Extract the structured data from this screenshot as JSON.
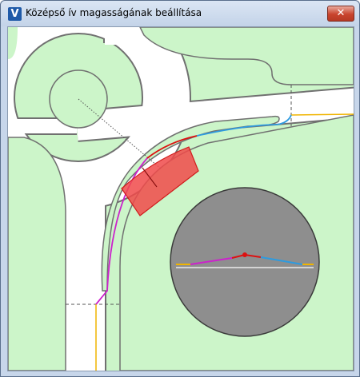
{
  "window": {
    "title": "Középső ív magasságának beállítása",
    "app_icon_letter": "V",
    "close_glyph": "✕"
  },
  "icons": {
    "app": "app-logo-icon",
    "close": "close-icon"
  },
  "colors": {
    "grass": "#ccf5c9",
    "road": "#ffffff",
    "road_edge": "#707070",
    "highlight_fill": "#f04a4a",
    "highlight_stroke": "#d01c1c",
    "profile_circle": "#8e8e8e",
    "segment_magenta": "#cc22cc",
    "segment_red": "#dd1111",
    "segment_blue": "#2d9be0",
    "segment_orange": "#f0b400"
  }
}
